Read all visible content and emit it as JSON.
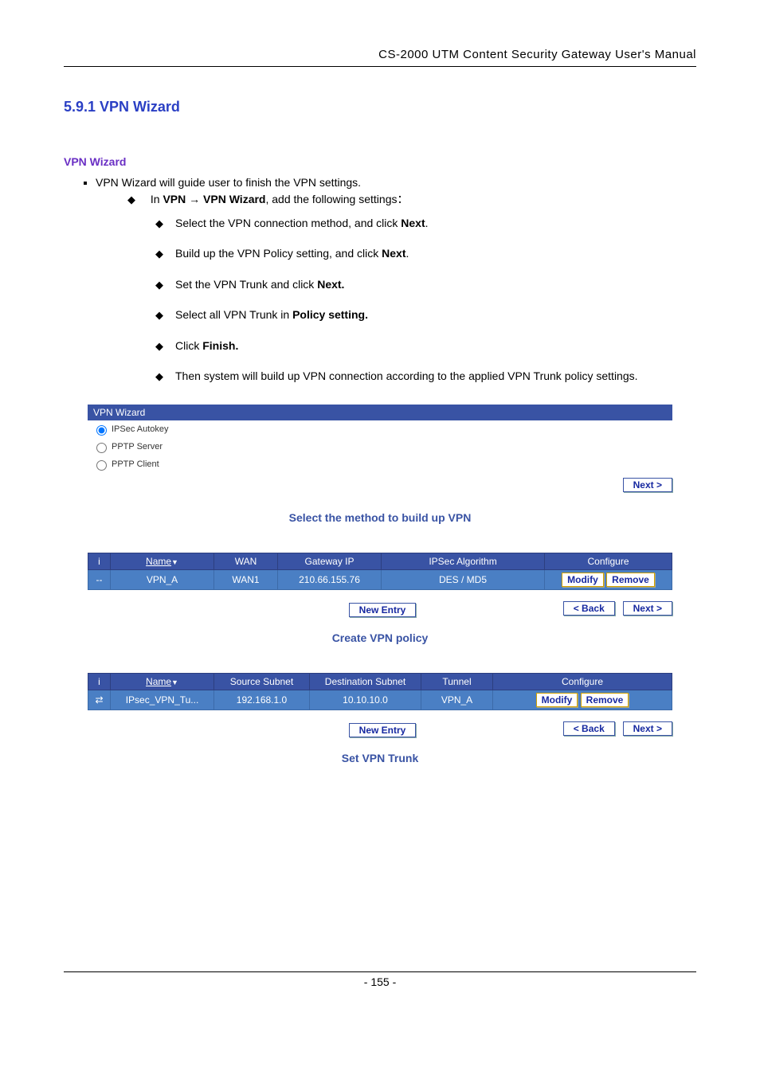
{
  "header": "CS-2000  UTM  Content  Security  Gateway  User's  Manual",
  "section_title": "5.9.1 VPN Wizard",
  "sub_title": "VPN Wizard",
  "intro_line": "VPN Wizard will guide user to finish the VPN settings.",
  "step_line_prefix": "In ",
  "step_line_bold": "VPN → VPN Wizard",
  "step_line_suffix": ", add the following settings：",
  "steps": {
    "s0a": "Select the VPN connection method, and click ",
    "s0b": "Next",
    "s0c": ".",
    "s1a": "Build up the VPN Policy setting, and click ",
    "s1b": "Next",
    "s1c": ".",
    "s2a": "Set the VPN Trunk and click ",
    "s2b": "Next.",
    "s3a": "Select all VPN Trunk in ",
    "s3b": "Policy setting.",
    "s4a": "Click ",
    "s4b": "Finish.",
    "s5": "Then system will build up VPN connection according to the applied VPN Trunk policy settings."
  },
  "wizard": {
    "title": "VPN Wizard",
    "opt1": "IPSec Autokey",
    "opt2": "PPTP Server",
    "opt3": "PPTP Client",
    "next": "Next >"
  },
  "caption1": "Select the method to build up VPN",
  "table1": {
    "headers": {
      "i": "i",
      "name": "Name",
      "wan": "WAN",
      "gw": "Gateway IP",
      "algo": "IPSec Algorithm",
      "cfg": "Configure"
    },
    "row": {
      "i": "--",
      "name": "VPN_A",
      "wan": "WAN1",
      "gw": "210.66.155.76",
      "algo": "DES / MD5"
    }
  },
  "buttons": {
    "modify": "Modify",
    "remove": "Remove",
    "newentry": "New  Entry",
    "back": "< Back",
    "next": "Next >"
  },
  "caption2": "Create VPN policy",
  "table2": {
    "headers": {
      "i": "i",
      "name": "Name",
      "src": "Source Subnet",
      "dst": "Destination Subnet",
      "tunnel": "Tunnel",
      "cfg": "Configure"
    },
    "row": {
      "name": "IPsec_VPN_Tu...",
      "src": "192.168.1.0",
      "dst": "10.10.10.0",
      "tunnel": "VPN_A"
    }
  },
  "caption3": "Set VPN Trunk",
  "page_number": "- 155 -"
}
